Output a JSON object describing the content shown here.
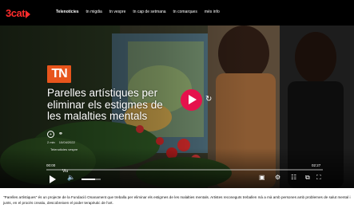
{
  "brand": {
    "logo_text": "3cat"
  },
  "nav": {
    "items": [
      "Telenotícies",
      "tn migdia",
      "tn vespre",
      "tn cap de setmana",
      "tn comarques",
      "més info"
    ]
  },
  "video": {
    "badge": "TN",
    "title": "Parelles artístiques per eliminar els estigmes de les malalties mentals",
    "duration": "2 min",
    "date": "10/04/2022",
    "program": "Telenotícies vespre",
    "time_current": "00:00",
    "time_total": "02:27",
    "live_label": "Viu",
    "progress": 0.0,
    "volume": 0.7
  },
  "controls": {
    "play": "play-icon",
    "volume": "volume-icon",
    "subtitles": "subtitles-icon",
    "settings": "gear-icon",
    "chapters": "chapters-icon",
    "pip": "picture-in-picture-icon",
    "fullscreen": "fullscreen-icon"
  },
  "caption": {
    "text": "\"Parelles artístiques\" és un projecte de la Fundació Onanament que treballa per eliminar els estigmes de les malalties mentals. Artistes reconeguts treballen mà a mà amb persones amb problemes de salut mental i junts, en el procés creatiu, descobreixen el poder terapèutic de l'art."
  },
  "colors": {
    "brand_red": "#ff2c2c",
    "tn_orange": "#e8551c",
    "play_pink": "#e5124c"
  }
}
